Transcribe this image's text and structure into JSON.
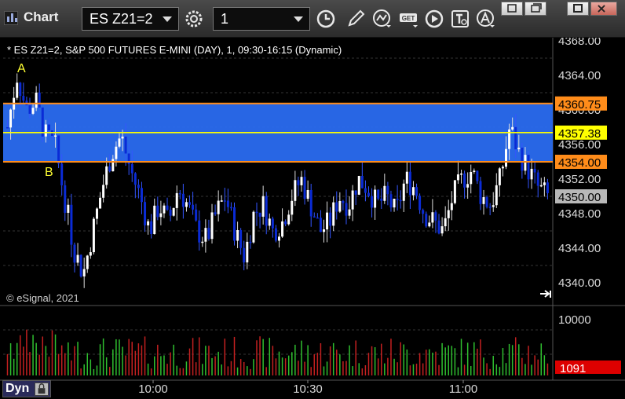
{
  "toolbar": {
    "title": "Chart",
    "symbol": "ES Z21=2",
    "interval": "1"
  },
  "chart": {
    "header": "* ES Z21=2, S&P 500 FUTURES E-MINI (DAY), 1, 09:30-16:15 (Dynamic)",
    "copyright": "© eSignal, 2021",
    "annotations": [
      "A",
      "B"
    ],
    "price_ticks": [
      "4368.00",
      "4364.00",
      "4360.00",
      "4356.00",
      "4352.00",
      "4348.00",
      "4344.00",
      "4340.00"
    ],
    "volume_tick": "10000",
    "time_ticks": [
      "10:00",
      "10:30",
      "11:00"
    ],
    "price_labels": [
      {
        "text": "4360.75",
        "color": "#ff8c1a"
      },
      {
        "text": "4357.38",
        "color": "#ffff00"
      },
      {
        "text": "4354.00",
        "color": "#ff8c1a"
      },
      {
        "text": "4350.00",
        "color": "#b8b8b8"
      }
    ],
    "volume_label": {
      "text": "1091",
      "color": "#dd0000"
    },
    "bottom_tab": "Dyn"
  },
  "chart_data": {
    "type": "candlestick",
    "y_range": [
      4338,
      4369
    ],
    "zones": {
      "upper": 4360.75,
      "lower": 4354.0,
      "mid": 4357.38
    },
    "last_price": 4350.0,
    "volume_max": 10000,
    "last_volume": 1091
  }
}
